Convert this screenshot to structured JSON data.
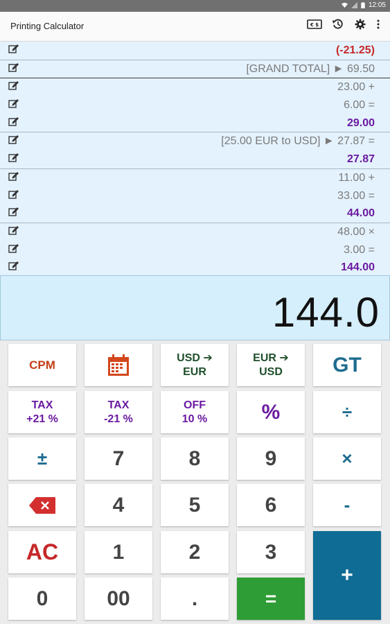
{
  "status_bar": {
    "time": "12:05"
  },
  "app_bar": {
    "title": "Printing Calculator",
    "icons": [
      "currency-icon",
      "history-icon",
      "settings-icon",
      "more-icon"
    ]
  },
  "tape": [
    {
      "text": "(-21.25)",
      "style": "neg",
      "sep": ""
    },
    {
      "text": "[GRAND TOTAL] ► 69.50",
      "style": "",
      "sep": "sep"
    },
    {
      "text": "23.00 +",
      "style": "",
      "sep": "sep-dark"
    },
    {
      "text": "6.00 =",
      "style": "",
      "sep": ""
    },
    {
      "text": "29.00",
      "style": "res",
      "sep": ""
    },
    {
      "text": "[25.00 EUR to USD] ► 27.87 =",
      "style": "",
      "sep": "sep"
    },
    {
      "text": "27.87",
      "style": "res",
      "sep": ""
    },
    {
      "text": "11.00 +",
      "style": "",
      "sep": "sep"
    },
    {
      "text": "33.00 =",
      "style": "",
      "sep": ""
    },
    {
      "text": "44.00",
      "style": "res",
      "sep": ""
    },
    {
      "text": "48.00 ×",
      "style": "",
      "sep": "sep"
    },
    {
      "text": "3.00 =",
      "style": "",
      "sep": ""
    },
    {
      "text": "144.00",
      "style": "res",
      "sep": ""
    }
  ],
  "display": {
    "value": "144.0"
  },
  "keys": {
    "cpm": "CPM",
    "usd_eur": [
      "USD ➔",
      "EUR"
    ],
    "eur_usd": [
      "EUR ➔",
      "USD"
    ],
    "gt": "GT",
    "tax_plus": [
      "TAX",
      "+21 %"
    ],
    "tax_minus": [
      "TAX",
      "-21 %"
    ],
    "off": [
      "OFF",
      "10 %"
    ],
    "percent": "%",
    "divide": "÷",
    "plusminus": "±",
    "seven": "7",
    "eight": "8",
    "nine": "9",
    "multiply": "×",
    "four": "4",
    "five": "5",
    "six": "6",
    "minus": "-",
    "ac": "AC",
    "one": "1",
    "two": "2",
    "three": "3",
    "plus": "+",
    "zero": "0",
    "double_zero": "00",
    "decimal": ".",
    "equals": "="
  },
  "colors": {
    "tape_bg": "#e4f2fd",
    "display_bg": "#d6effc",
    "equals_key": "#2e9d35",
    "plus_key": "#0f6c94",
    "result_text": "#6a1aa0",
    "negative_text": "#c62828"
  }
}
